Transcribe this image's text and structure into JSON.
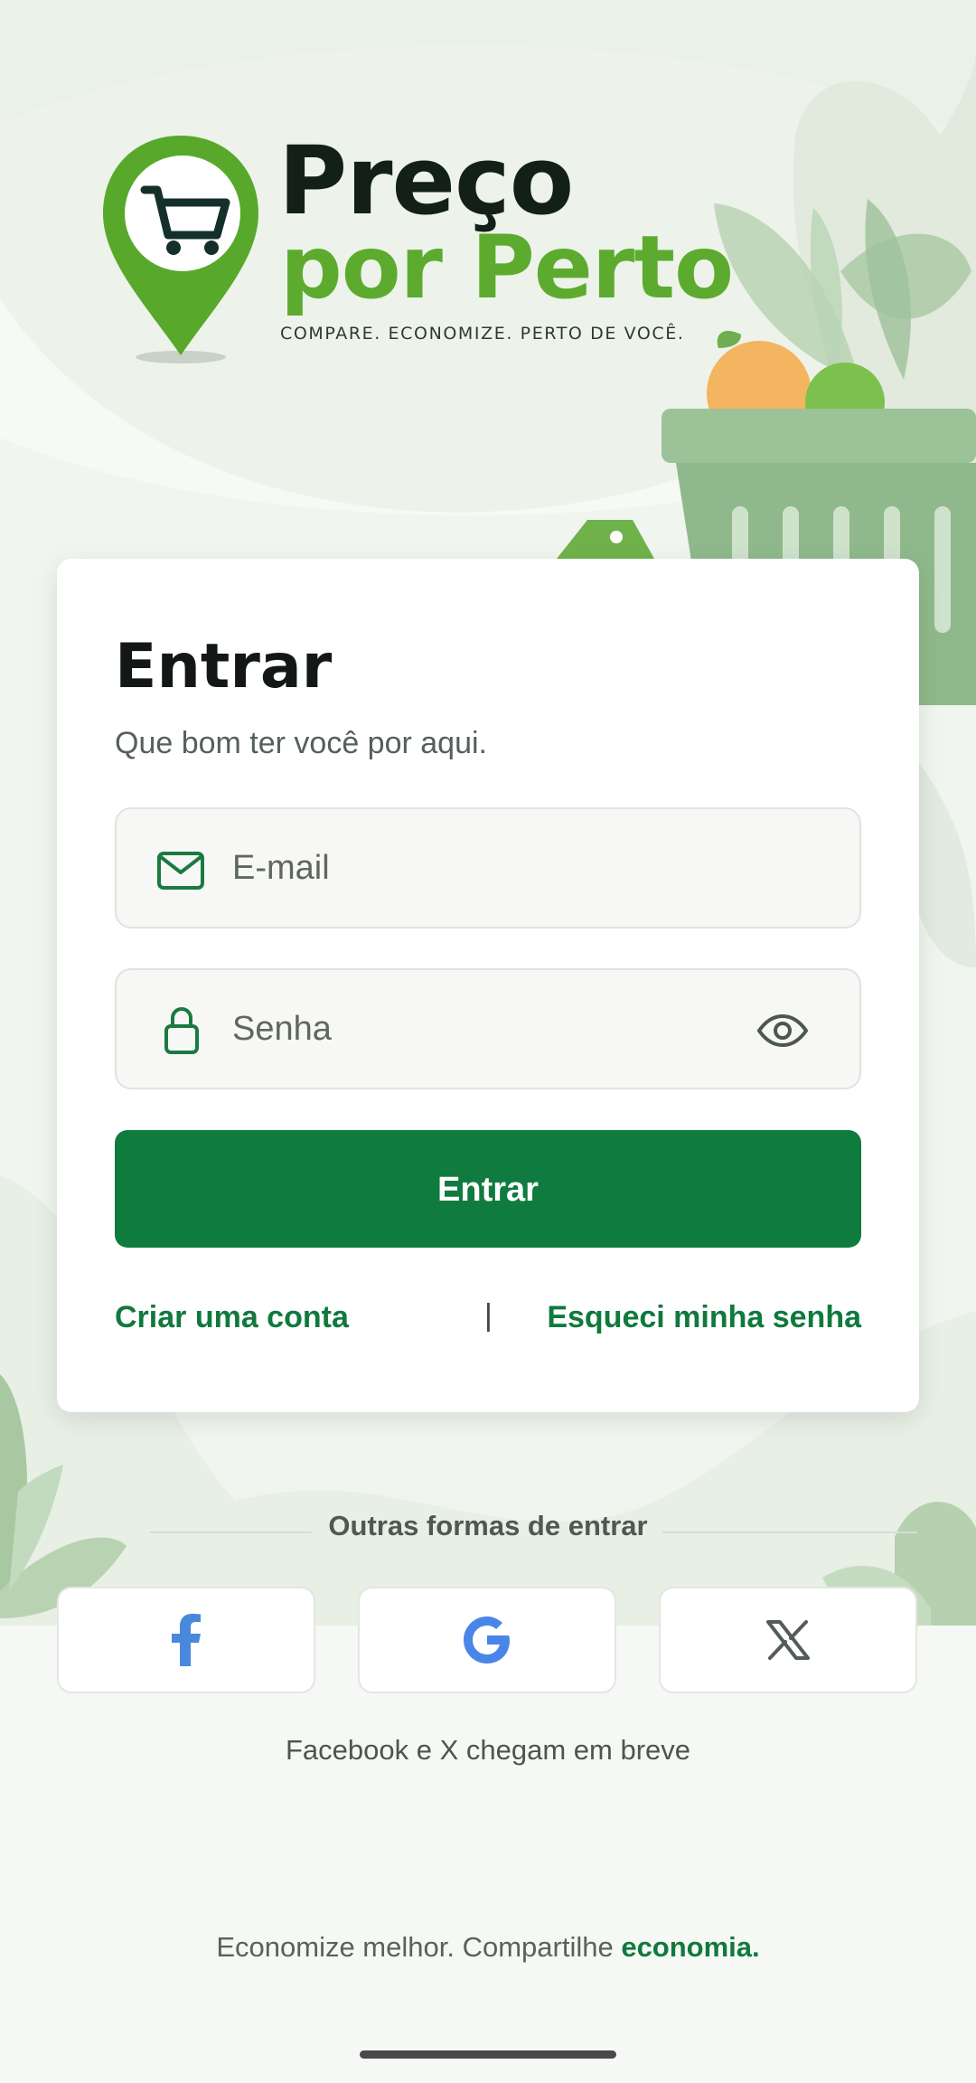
{
  "brand": {
    "name_line1": "Preço",
    "name_line2": "por Perto",
    "tagline": "COMPARE. ECONOMIZE. PERTO DE VOCÊ."
  },
  "login": {
    "title": "Entrar",
    "subtitle": "Que bom ter você por aqui.",
    "email_placeholder": "E-mail",
    "password_placeholder": "Senha",
    "submit_label": "Entrar",
    "create_account": "Criar uma conta",
    "separator": "|",
    "forgot_password": "Esqueci minha senha"
  },
  "social": {
    "heading": "Outras formas de entrar",
    "providers": [
      {
        "name": "Facebook",
        "icon": "facebook-icon"
      },
      {
        "name": "Google",
        "icon": "google-icon"
      },
      {
        "name": "X",
        "icon": "x-icon"
      }
    ],
    "notice": "Facebook e X chegam em breve"
  },
  "footer": {
    "text": "Economize melhor. Compartilhe ",
    "highlight": "economia."
  },
  "colors": {
    "primary": "#0f7b3f",
    "brand_green": "#5cab2e",
    "dark": "#132017"
  }
}
